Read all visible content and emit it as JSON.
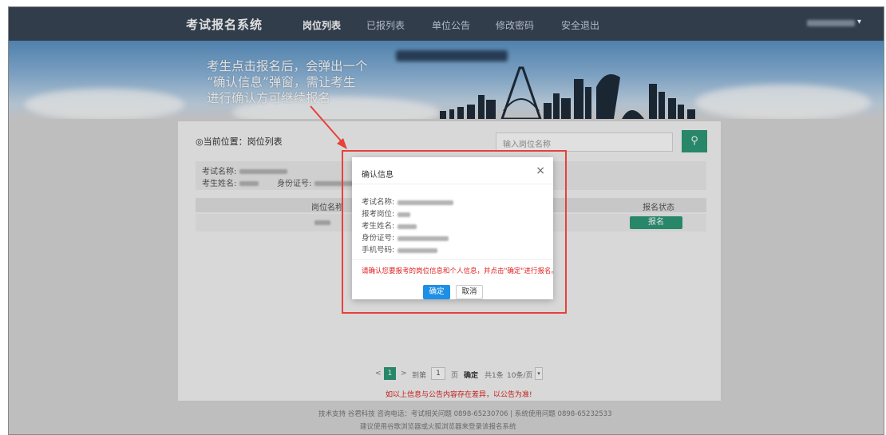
{
  "nav": {
    "brand": "考试报名系统",
    "items": [
      {
        "label": "岗位列表",
        "active": true
      },
      {
        "label": "已报列表",
        "active": false
      },
      {
        "label": "单位公告",
        "active": false
      },
      {
        "label": "修改密码",
        "active": false
      },
      {
        "label": "安全退出",
        "active": false
      }
    ],
    "user_caret": "▾"
  },
  "annotation": "考生点击报名后，会弹出一个\n“确认信息”弹窗，需让考生\n进行确认方可继续报名",
  "breadcrumb": "◎当前位置：岗位列表",
  "search": {
    "placeholder": "输入岗位名称",
    "button_icon": "search-icon"
  },
  "info": {
    "exam_name_label": "考试名称:",
    "name_label": "考生姓名:",
    "id_label": "身份证号:"
  },
  "table": {
    "headers": [
      "岗位名称",
      "报名状态"
    ],
    "rows": [
      {
        "action": "报名"
      }
    ]
  },
  "pager": {
    "prev": "<",
    "current": "1",
    "next": ">",
    "goto_label": "到第",
    "page_input": "1",
    "page_suffix": "页",
    "confirm": "确定",
    "total": "共1条",
    "per_page": "10条/页"
  },
  "notice": "如以上信息与公告内容存在差异，以公告为准!",
  "footer": {
    "line1": "技术支持 谷君科技 咨询电话：考试相关问题 0898-65230706 | 系统使用问题 0898-65232533",
    "line2": "建议使用谷歌浏览器或火狐浏览器来登录该报名系统"
  },
  "modal": {
    "title": "确认信息",
    "close": "×",
    "fields": [
      {
        "label": "考试名称:"
      },
      {
        "label": "报考岗位:"
      },
      {
        "label": "考生姓名:"
      },
      {
        "label": "身份证号:"
      },
      {
        "label": "手机号码:"
      }
    ],
    "warning": "请确认您要报考的岗位信息和个人信息，并点击\"确定\"进行报名。",
    "ok": "确定",
    "cancel": "取消"
  },
  "colors": {
    "nav_bg": "#3a4656",
    "accent": "#2e9a78",
    "primary": "#1e8fe6",
    "highlight": "#e8403a",
    "warning": "#e02020"
  }
}
